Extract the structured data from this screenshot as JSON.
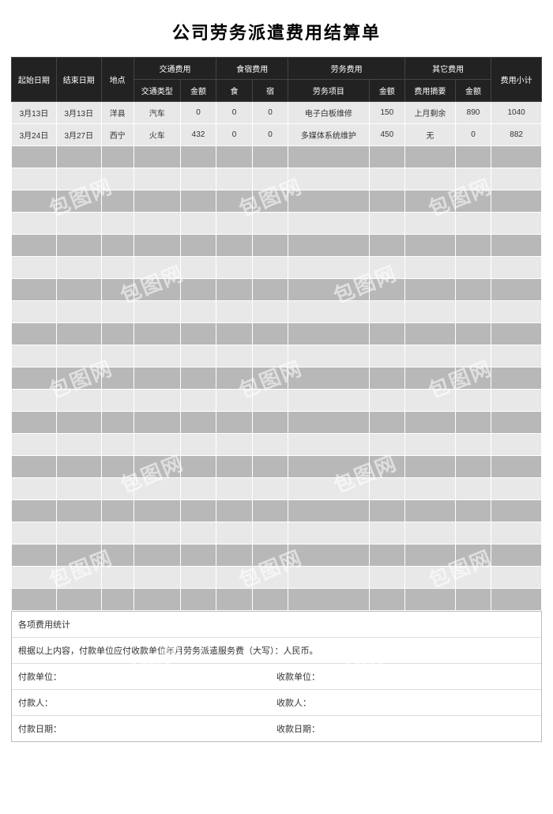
{
  "title": "公司劳务派遣费用结算单",
  "header": {
    "start_date": "起始日期",
    "end_date": "结束日期",
    "location": "地点",
    "transport_group": "交通费用",
    "transport_type": "交通类型",
    "transport_amount": "金额",
    "lodging_group": "食宿费用",
    "food": "食",
    "lodging": "宿",
    "labor_group": "劳务费用",
    "labor_item": "劳务项目",
    "labor_amount": "金额",
    "other_group": "其它费用",
    "other_summary": "费用摘要",
    "other_amount": "金额",
    "subtotal": "费用小计"
  },
  "rows": [
    {
      "start_date": "3月13日",
      "end_date": "3月13日",
      "location": "洋县",
      "transport_type": "汽车",
      "transport_amount": "0",
      "food": "0",
      "lodging": "0",
      "labor_item": "电子白板维修",
      "labor_amount": "150",
      "other_summary": "上月剩余",
      "other_amount": "890",
      "subtotal": "1040"
    },
    {
      "start_date": "3月24日",
      "end_date": "3月27日",
      "location": "西宁",
      "transport_type": "火车",
      "transport_amount": "432",
      "food": "0",
      "lodging": "0",
      "labor_item": "多媒体系统维护",
      "labor_amount": "450",
      "other_summary": "无",
      "other_amount": "0",
      "subtotal": "882"
    }
  ],
  "empty_row_count": 21,
  "footer": {
    "stats_label": "各项费用统计",
    "statement": "根据以上内容，付款单位应付收款单位年月劳务派遣服务费（大写）：人民币。",
    "payer_unit": "付款单位：",
    "payee_unit": "收款单位：",
    "payer_person": "付款人：",
    "payee_person": "收款人：",
    "pay_date": "付款日期：",
    "receive_date": "收款日期："
  },
  "watermark_text": "包图网"
}
